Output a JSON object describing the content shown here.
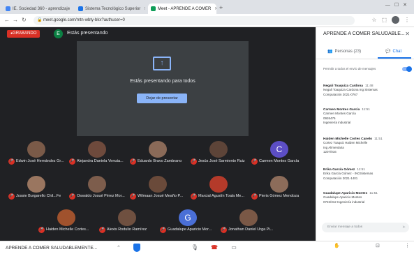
{
  "browser": {
    "tabs": [
      {
        "title": "IE. Sociedad 360 - aprendizaje",
        "fav": "#4285f4"
      },
      {
        "title": "Sistema Tecnológico Superior",
        "fav": "#1a73e8"
      },
      {
        "title": "Meet - APRENDE A COMER",
        "fav": "#0f9d58",
        "active": true
      }
    ],
    "new_tab": "+",
    "url": "meet.google.com/mtn-wbty-bkx?authuser=0"
  },
  "stage": {
    "recording_label": "GRABANDO",
    "presenter_initial": "E",
    "presenter_label": "Estás presentando",
    "present_message": "Estás presentando para todos",
    "stop_button": "Dejar de presentar"
  },
  "participants": [
    {
      "name": "Edwin José Hernández Gr...",
      "face": "#7a5a48"
    },
    {
      "name": "Alejandra Daniela Venuta...",
      "face": "#6e4a3c"
    },
    {
      "name": "Eduardo Bravo Zambrano",
      "face": "#8a6a58"
    },
    {
      "name": "Jesús José Sarmiento Ruiz",
      "face": "#5d4438"
    },
    {
      "name": "Carmen Montes García",
      "face": "#5c4ec5",
      "letter": "C"
    },
    {
      "name": "Jossie Burgarello Chil...Fe",
      "face": "#9a7660"
    },
    {
      "name": "Oswaldo Josué Pérez Mor...",
      "face": "#7d5d4c"
    },
    {
      "name": "Wilmaan Josué Meaño P...",
      "face": "#6a4a3a"
    },
    {
      "name": "Marcial Agustín Toala Me...",
      "face": "#b43a2a"
    },
    {
      "name": "Pieris Gómez Mendoza",
      "face": "#8c6c5a"
    },
    {
      "name": "Haiden Michelle Cortes...",
      "face": "#a0522d"
    },
    {
      "name": "Alexis Rodulio Ramírez",
      "face": "#6f5040"
    },
    {
      "name": "Guadalupe Aparicio Mor...",
      "face": "#4a6fd6",
      "letter": "G"
    },
    {
      "name": "Jonathan Daniel Urga Pi...",
      "face": "#7a5846"
    }
  ],
  "side_panel": {
    "title": "APRENDE A COMER SALUDABLE...",
    "tab_people": "Personas (23)",
    "tab_chat": "Chat",
    "allow_messages": "Permitir a todos el envío de mensajes",
    "messages": [
      {
        "who": "Negali Toaquiza Cardona",
        "time": "11:48",
        "lines": [
          "Negali Toaquiza Cardona Ing Sistemas",
          "Computación 2021-0767"
        ]
      },
      {
        "who": "Carmen Montes García",
        "time": "11:51",
        "lines": [
          "Carmen Montes García",
          "0926476",
          "Ingeniería industrial"
        ]
      },
      {
        "who": "Haiden Michelle Cortes Canelo",
        "time": "11:51",
        "lines": [
          "Cortez Toaquiz Haiden Michelle",
          "Ing Alimentaria",
          "1207/016"
        ]
      },
      {
        "who": "Erika García Gómez",
        "time": "11:51",
        "lines": [
          "Erika García Gómez - INGSistemas",
          "Computación 2021-1401"
        ]
      },
      {
        "who": "Guadalupe Aparicio Montes",
        "time": "11:51",
        "lines": [
          "Guadalupe Aparicio Montes",
          "0722/312 Ingeniería industrial"
        ]
      }
    ],
    "chat_placeholder": "Enviar mensaje a todos"
  },
  "bottom_bar": {
    "meeting_name": "APRENDE A COMER SALUDABLEMENTE..."
  },
  "icons": {
    "people": "people-icon",
    "chat": "chat-icon",
    "mic": "mic-icon",
    "hangup": "hangup-icon",
    "present": "present-icon",
    "shield": "shield-icon"
  },
  "colors": {
    "recording": "#d93025",
    "accent": "#1a73e8",
    "stage_bg": "#202124"
  }
}
